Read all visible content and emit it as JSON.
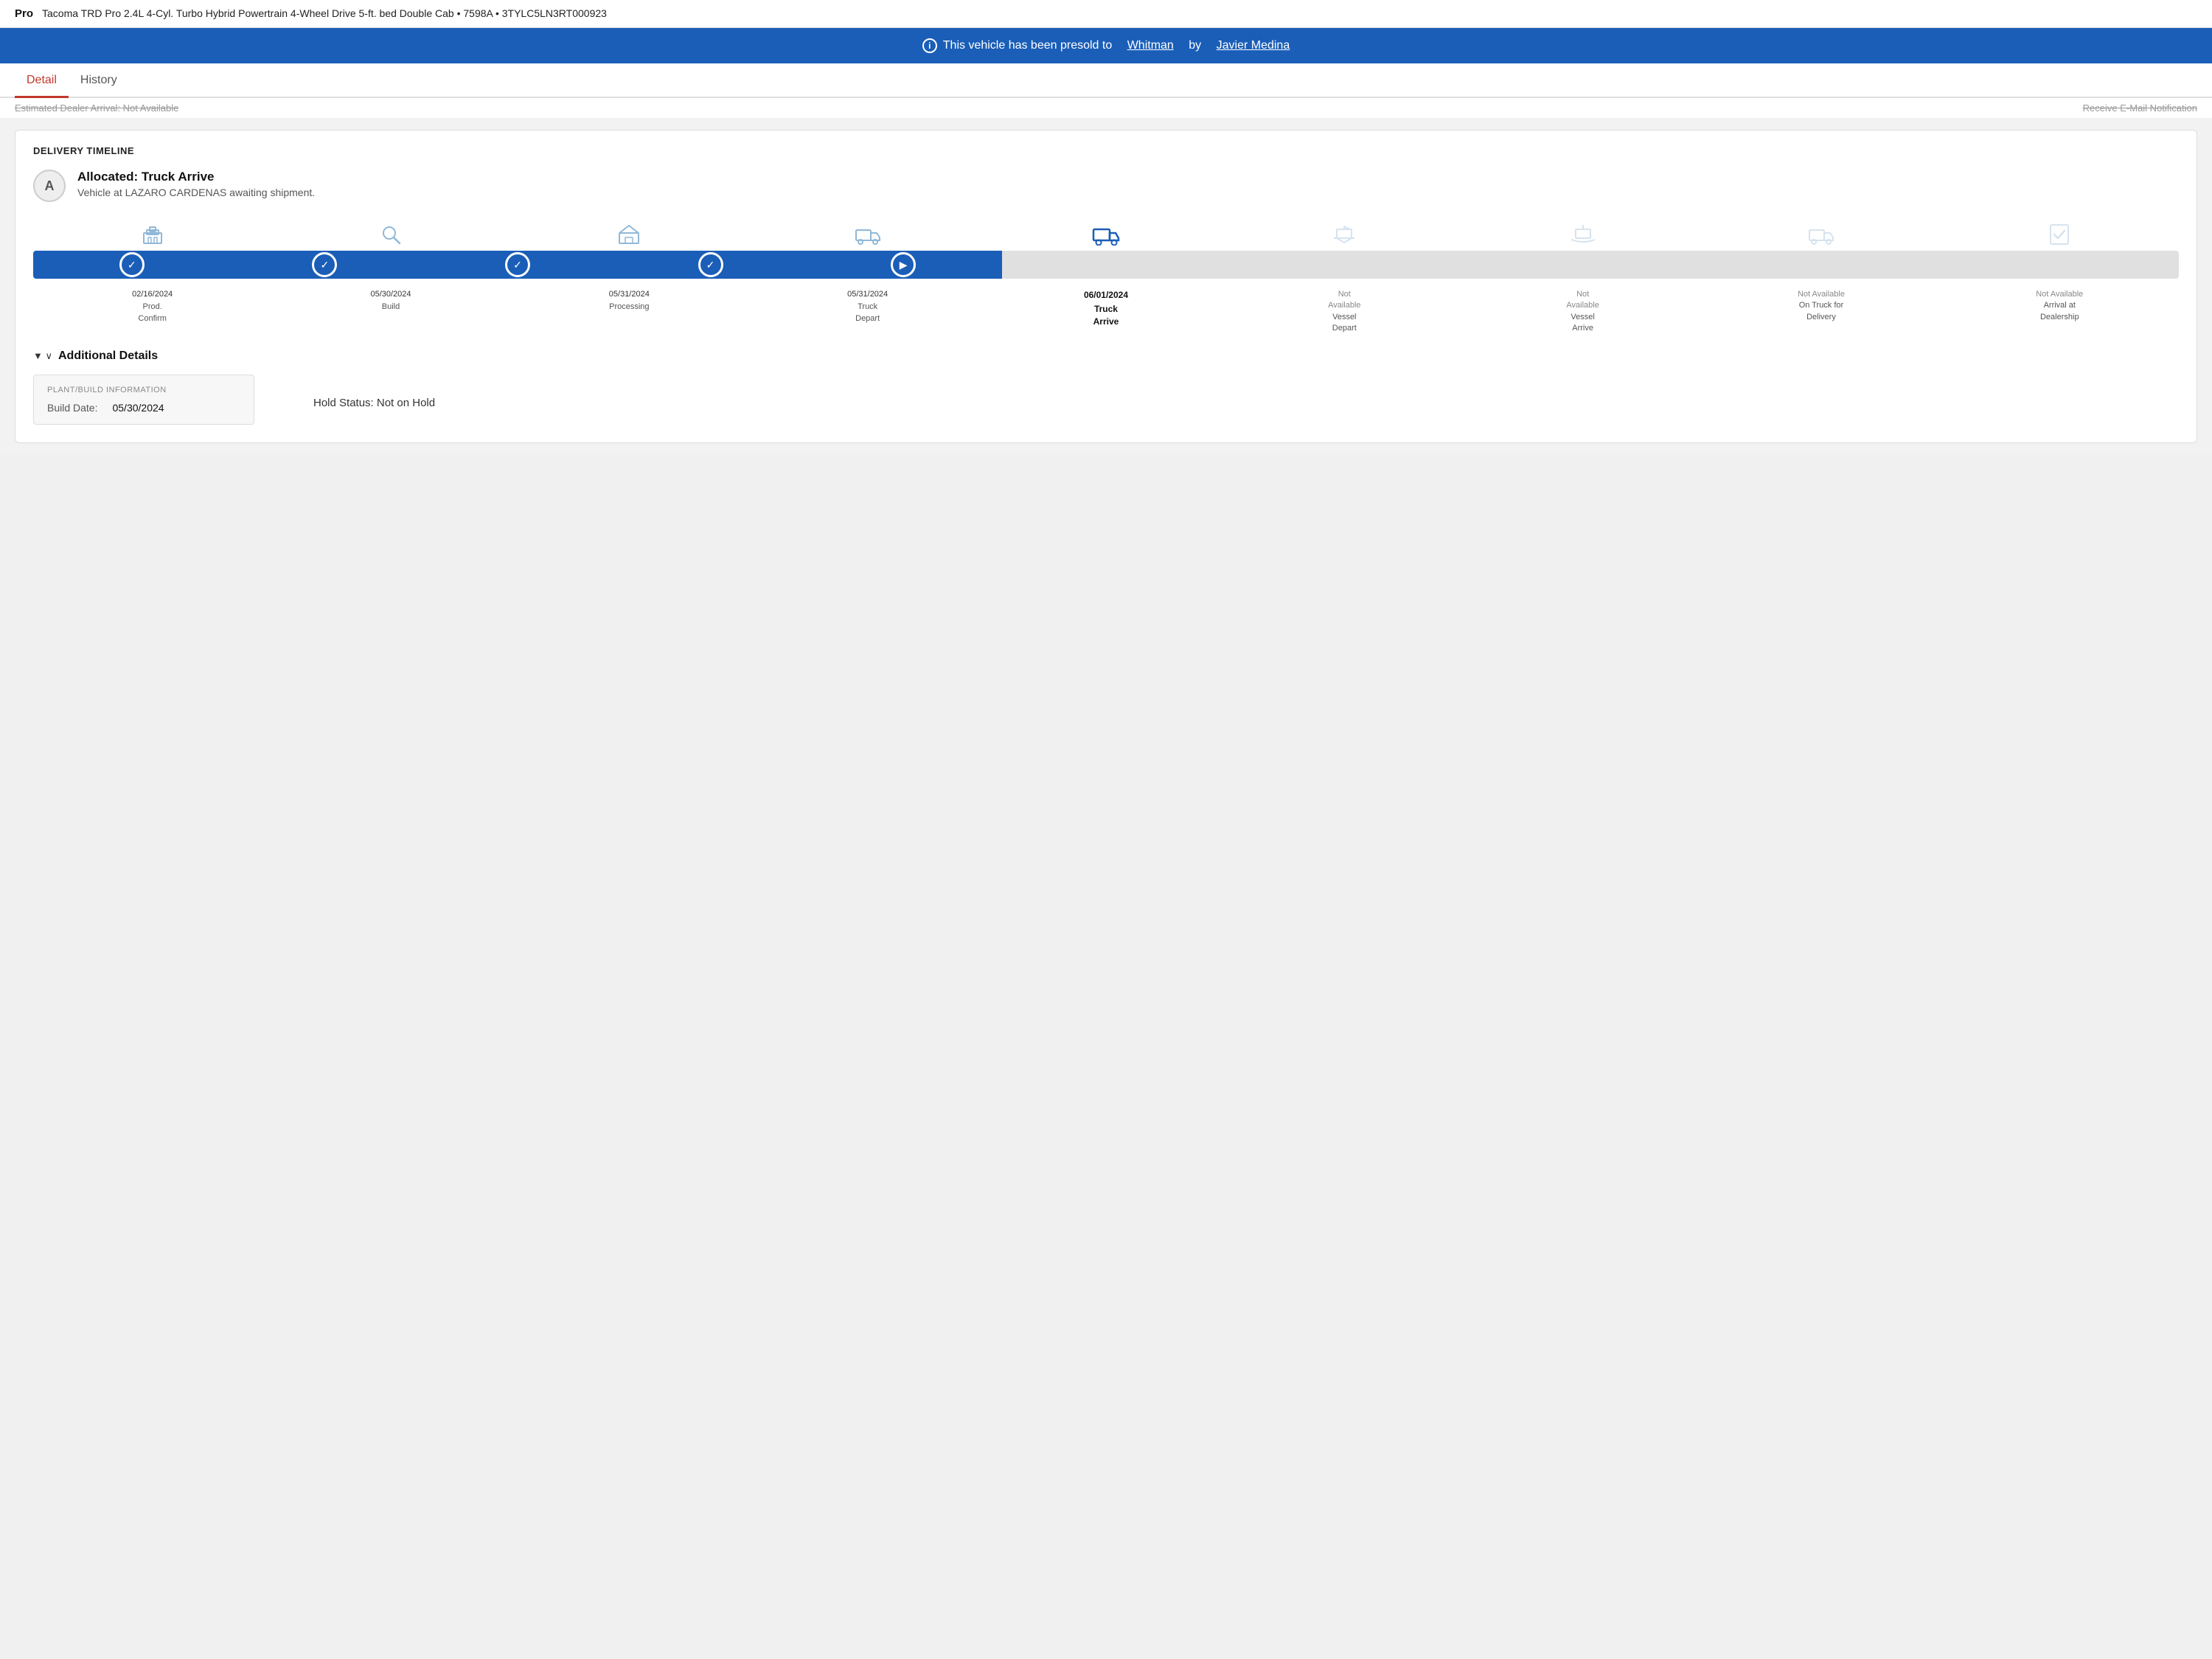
{
  "header": {
    "pro_label": "Pro",
    "vehicle_title": "Tacoma TRD Pro 2.4L 4-Cyl. Turbo Hybrid Powertrain 4-Wheel Drive 5-ft. bed Double Cab • 7598A • 3TYLC5LN3RT000923"
  },
  "presold_banner": {
    "text_prefix": "This vehicle has been presold to",
    "buyer": "Whitman",
    "text_by": "by",
    "seller": "Javier Medina"
  },
  "tabs": {
    "detail_label": "Detail",
    "history_label": "History"
  },
  "strikethrough": {
    "left": "Estimated Dealer Arrival: Not Available",
    "right": "Receive E-Mail Notification"
  },
  "timeline": {
    "section_label": "DELIVERY TIMELINE",
    "status_circle": "A",
    "status_title": "Allocated: Truck Arrive",
    "status_desc": "Vehicle at LAZARO CARDENAS awaiting shipment.",
    "steps": [
      {
        "date": "02/16/2024",
        "name": "Prod.\nConfirm",
        "state": "completed"
      },
      {
        "date": "05/30/2024",
        "name": "Build",
        "state": "completed"
      },
      {
        "date": "05/31/2024",
        "name": "Processing",
        "state": "completed"
      },
      {
        "date": "05/31/2024",
        "name": "Truck\nDepart",
        "state": "completed"
      },
      {
        "date": "06/01/2024",
        "name": "Truck\nArrive",
        "bold": true,
        "state": "current"
      },
      {
        "date": "Not\nAvailable",
        "name": "Vessel\nDepart",
        "state": "upcoming"
      },
      {
        "date": "Not\nAvailable",
        "name": "Vessel\nArrive",
        "state": "upcoming"
      },
      {
        "date": "Not Available",
        "name": "On Truck for\nDelivery",
        "state": "upcoming"
      },
      {
        "date": "Not Available",
        "name": "Arrival at\nDealership",
        "state": "upcoming"
      }
    ]
  },
  "additional_details": {
    "title": "Additional Details",
    "plant_section_label": "PLANT/BUILD INFORMATION",
    "build_date_label": "Build Date:",
    "build_date_value": "05/30/2024",
    "hold_status": "Hold Status: Not on Hold"
  }
}
